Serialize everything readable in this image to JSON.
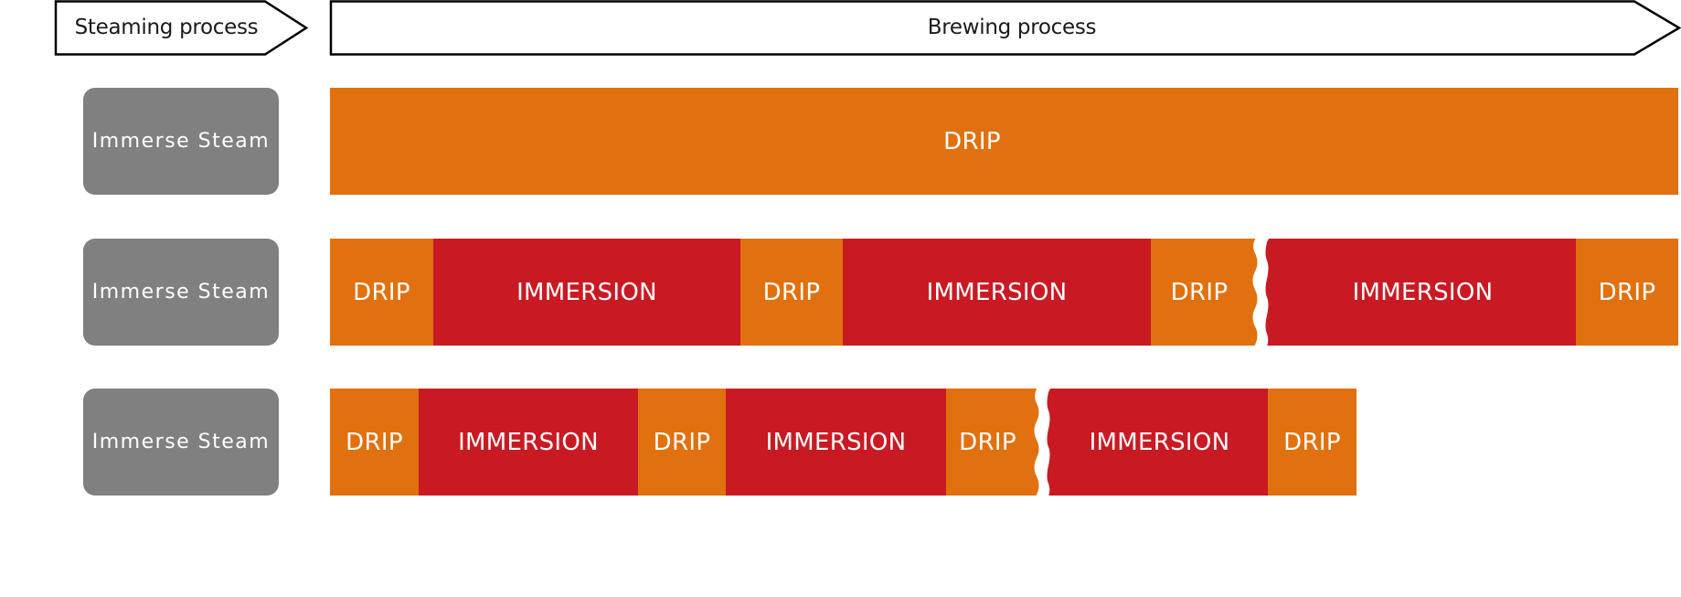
{
  "colors": {
    "drip": "#E0710E",
    "immersion": "#C91A23",
    "steam": "#808080",
    "background": "#FFFFFF",
    "outline": "#000000"
  },
  "header": {
    "steaming_label": "Steaming process",
    "brewing_label": "Brewing process"
  },
  "rows": [
    {
      "steam_label": "Immerse Steam",
      "segments": [
        {
          "type": "drip",
          "label": "DRIP"
        }
      ]
    },
    {
      "steam_label": "Immerse Steam",
      "segments": [
        {
          "type": "drip",
          "label": "DRIP"
        },
        {
          "type": "immersion",
          "label": "IMMERSION"
        },
        {
          "type": "drip",
          "label": "DRIP"
        },
        {
          "type": "immersion",
          "label": "IMMERSION"
        },
        {
          "type": "drip",
          "label": "DRIP",
          "break_after": true
        },
        {
          "type": "immersion",
          "label": "IMMERSION"
        },
        {
          "type": "drip",
          "label": "DRIP"
        }
      ]
    },
    {
      "steam_label": "Immerse Steam",
      "segments": [
        {
          "type": "drip",
          "label": "DRIP"
        },
        {
          "type": "immersion",
          "label": "IMMERSION"
        },
        {
          "type": "drip",
          "label": "DRIP"
        },
        {
          "type": "immersion",
          "label": "IMMERSION"
        },
        {
          "type": "drip",
          "label": "DRIP",
          "break_after": true
        },
        {
          "type": "immersion",
          "label": "IMMERSION"
        },
        {
          "type": "drip",
          "label": "DRIP"
        }
      ]
    }
  ]
}
